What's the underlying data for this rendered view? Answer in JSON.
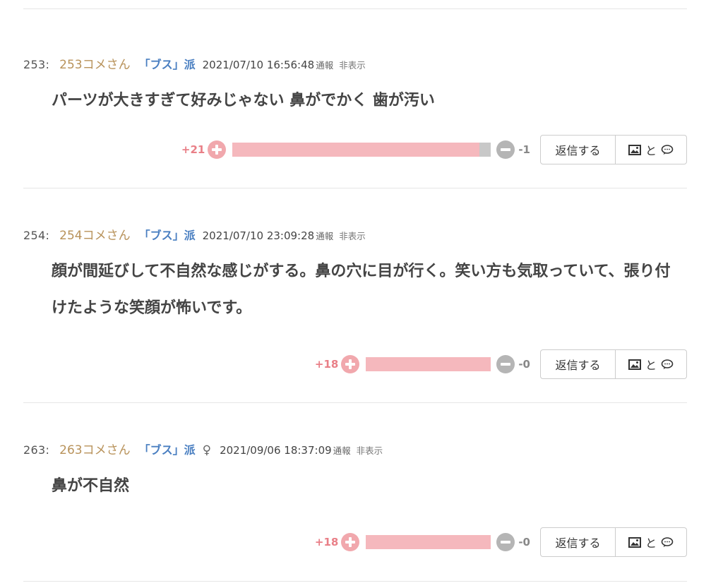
{
  "comments": [
    {
      "num": "253:",
      "author": "253コメさん",
      "faction": "「ブス」派",
      "gender": "",
      "date": "2021/07/10 16:56:48",
      "report": "通報",
      "hide": "非表示",
      "body": "パーツが大きすぎて好みじゃない 鼻がでかく 歯が汚い",
      "plus": "+21",
      "minus": "-1",
      "plus_ratio": 0.955,
      "reply_label": "返信する",
      "media_label": "と"
    },
    {
      "num": "254:",
      "author": "254コメさん",
      "faction": "「ブス」派",
      "gender": "",
      "date": "2021/07/10 23:09:28",
      "report": "通報",
      "hide": "非表示",
      "body": "顔が間延びして不自然な感じがする。鼻の穴に目が行く。笑い方も気取っていて、張り付けたような笑顔が怖いです。",
      "plus": "+18",
      "minus": "-0",
      "plus_ratio": 1.0,
      "reply_label": "返信する",
      "media_label": "と"
    },
    {
      "num": "263:",
      "author": "263コメさん",
      "faction": "「ブス」派",
      "gender": "♀",
      "date": "2021/09/06 18:37:09",
      "report": "通報",
      "hide": "非表示",
      "body": "鼻が不自然",
      "plus": "+18",
      "minus": "-0",
      "plus_ratio": 1.0,
      "reply_label": "返信する",
      "media_label": "と"
    }
  ],
  "colors": {
    "plus": "#f5b8bd",
    "minus": "#c8c8c8",
    "author": "#b8925a",
    "faction": "#4a7fc1"
  },
  "icons": {
    "plus": "plus-circle-icon",
    "minus": "minus-circle-icon",
    "image": "image-icon",
    "comment": "speech-bubble-icon"
  }
}
